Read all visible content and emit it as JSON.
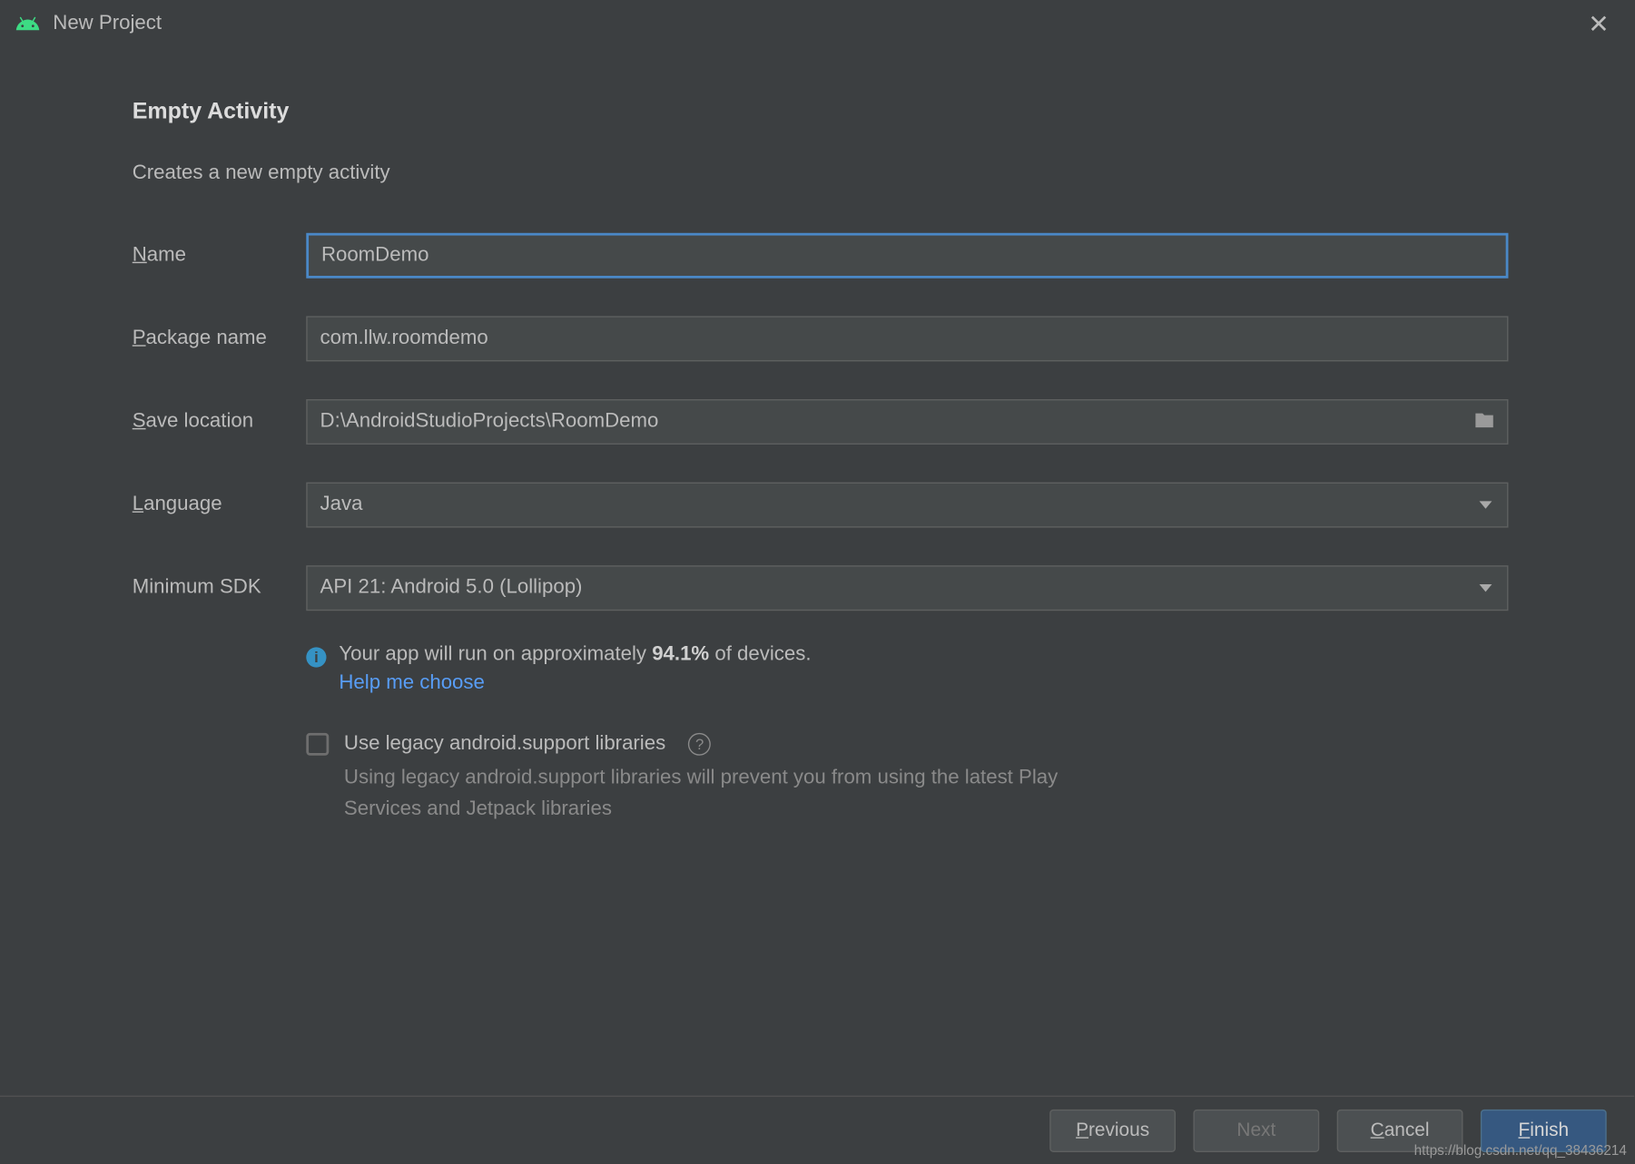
{
  "window": {
    "title": "New Project"
  },
  "header": {
    "title": "Empty Activity",
    "subtitle": "Creates a new empty activity"
  },
  "fields": {
    "name": {
      "label": "Name",
      "mnemonic": "N",
      "rest": "ame",
      "value": "RoomDemo"
    },
    "package": {
      "label": "Package name",
      "mnemonic": "P",
      "rest": "ackage name",
      "value": "com.llw.roomdemo"
    },
    "save": {
      "label": "Save location",
      "mnemonic": "S",
      "rest": "ave location",
      "value": "D:\\AndroidStudioProjects\\RoomDemo"
    },
    "language": {
      "label": "Language",
      "mnemonic": "L",
      "rest": "anguage",
      "value": "Java"
    },
    "minsdk": {
      "label": "Minimum SDK",
      "value": "API 21: Android 5.0 (Lollipop)"
    }
  },
  "info": {
    "prefix": "Your app will run on approximately ",
    "percent": "94.1%",
    "suffix": " of devices.",
    "help_link": "Help me choose"
  },
  "legacy": {
    "checkbox_label": "Use legacy android.support libraries",
    "checked": false,
    "description": "Using legacy android.support libraries will prevent you from using the latest Play Services and Jetpack libraries"
  },
  "buttons": {
    "previous": "Previous",
    "next": "Next",
    "cancel": "Cancel",
    "finish": "Finish"
  },
  "watermark": "https://blog.csdn.net/qq_38436214"
}
